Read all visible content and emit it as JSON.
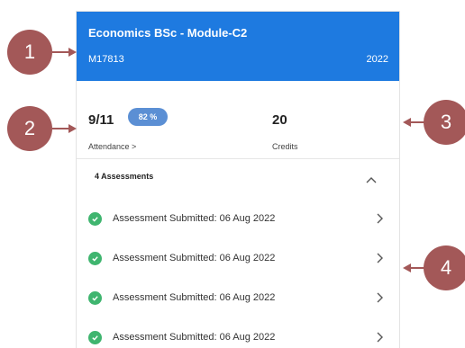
{
  "module": {
    "title": "Economics BSc - Module-C2",
    "code": "M17813",
    "year": "2022"
  },
  "stats": {
    "attendance_value": "9/11",
    "attendance_badge": "82 %",
    "attendance_label": "Attendance >",
    "credits_value": "20",
    "credits_label": "Credits"
  },
  "assessments": {
    "title": "4 Assessments",
    "items": [
      {
        "label": "Assessment Submitted: 06 Aug 2022"
      },
      {
        "label": "Assessment Submitted: 06 Aug 2022"
      },
      {
        "label": "Assessment Submitted: 06 Aug 2022"
      },
      {
        "label": "Assessment Submitted: 06 Aug 2022"
      }
    ]
  },
  "callouts": [
    "1",
    "2",
    "3",
    "4"
  ],
  "colors": {
    "header": "#1e7ae0",
    "badge": "#5b8fd4",
    "check": "#3fb56f",
    "callout": "#a35858"
  }
}
